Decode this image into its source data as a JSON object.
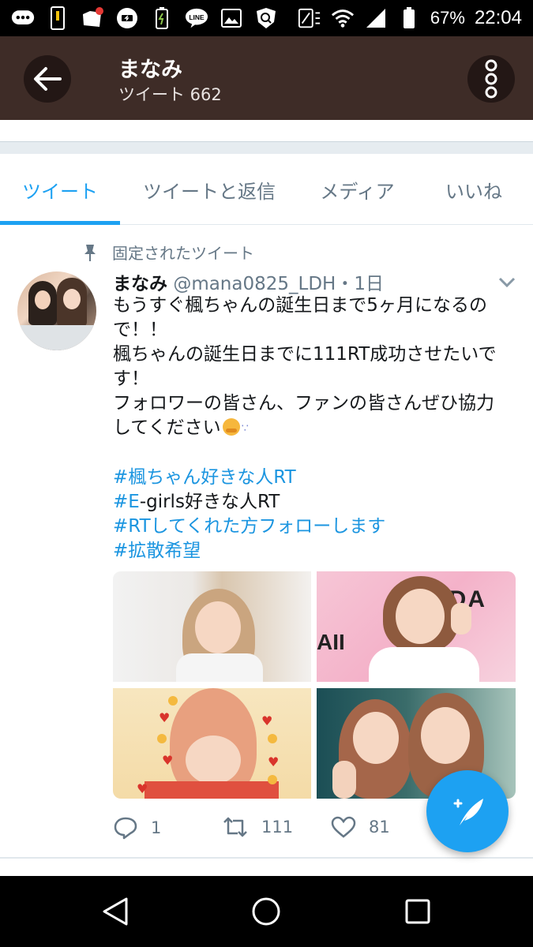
{
  "status_bar": {
    "battery_percent": "67%",
    "time": "22:04",
    "icons": [
      "chat-icon",
      "phone-icon",
      "folder-icon",
      "battery-saver-icon",
      "battery-charge-icon",
      "line-icon",
      "image-icon",
      "shield-icon",
      "nfc-icon",
      "wifi-icon",
      "signal-icon",
      "battery-icon"
    ]
  },
  "header": {
    "name": "まなみ",
    "tweet_count": "ツイート 662"
  },
  "tabs": [
    {
      "label": "ツイート",
      "active": true
    },
    {
      "label": "ツイートと返信",
      "active": false
    },
    {
      "label": "メディア",
      "active": false
    },
    {
      "label": "いいね",
      "active": false
    }
  ],
  "tweet": {
    "pinned_label": "固定されたツイート",
    "author_name": "まなみ",
    "handle_time": "@mana0825_LDH・1日",
    "lines": [
      "もうすぐ楓ちゃんの誕生日まで5ヶ月になるの",
      "で！！",
      "楓ちゃんの誕生日までに111RT成功させたいで",
      "す！",
      "フォロワーの皆さん、ファンの皆さんぜひ協力",
      "してください"
    ],
    "hashtags": [
      "#楓ちゃん好きな人RT",
      "#E-girls好きな人RT",
      "#RTしてくれた方フォローします",
      "#拡散希望"
    ],
    "hashtag_rest_2": "好きな人RT",
    "hashtag_link_2": "#E",
    "hashtag_mid_2": "-girls",
    "reply_count": "1",
    "retweet_count": "111",
    "like_count": "81"
  },
  "colors": {
    "header_bg": "#3e2c27",
    "accent": "#1da1f2",
    "link": "#1b95e0",
    "muted": "#657786"
  }
}
